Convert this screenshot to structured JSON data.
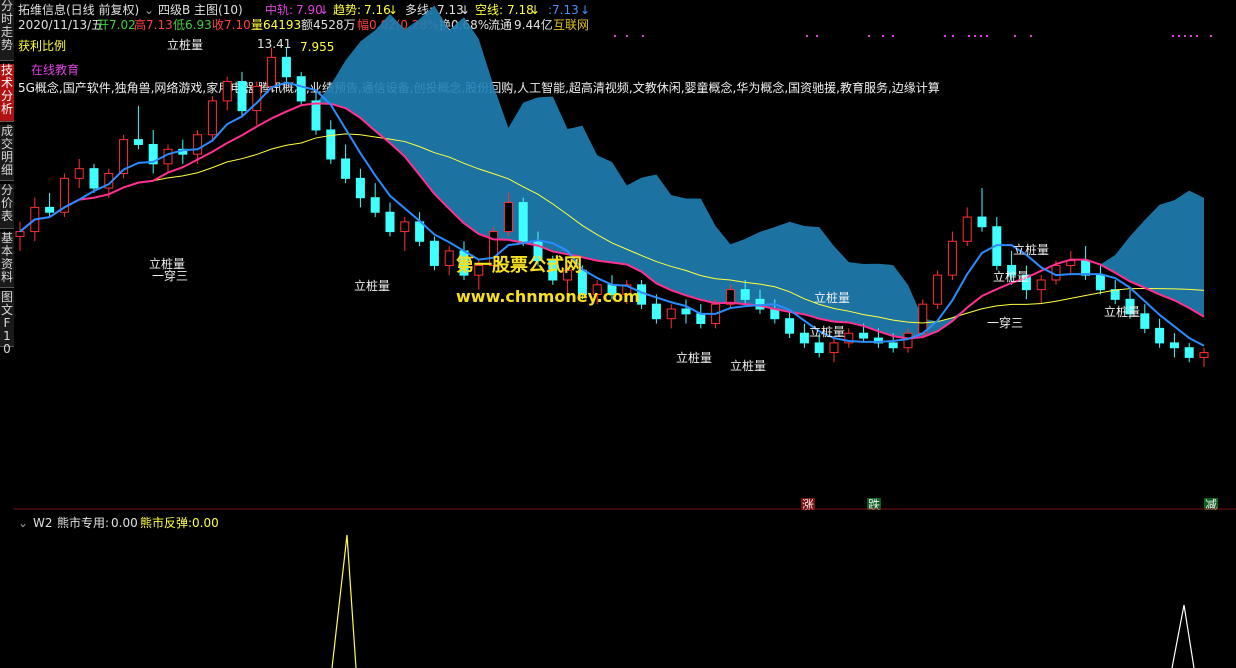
{
  "side_tabs": [
    {
      "label": "分时走势",
      "active": false
    },
    {
      "label": "技术分析",
      "active": true
    },
    {
      "label": "成交明细",
      "active": false
    },
    {
      "label": "分价表",
      "active": false
    },
    {
      "label": "基本资料",
      "active": false
    },
    {
      "label": "图文F10",
      "active": false
    }
  ],
  "header": {
    "stock_title": "拓维信息(日线 前复权)",
    "indicator_name": "四级B 主图(10)",
    "zhonggui_label": "中轨:",
    "zhonggui_value": "7.90",
    "qushi_label": "趋势:",
    "qushi_value": "7.16",
    "duoxian_label": "多线:",
    "duoxian_value": "7.13",
    "kongxian_label": "空线:",
    "kongxian_value": "7.18",
    "extra_value": ":7.13"
  },
  "quote": {
    "date": "2020/11/13/五",
    "open_label": "开",
    "open": "7.02",
    "high_label": "高",
    "high": "7.13",
    "low_label": "低",
    "low": "6.93",
    "close_label": "收",
    "close": "7.10",
    "vol_label": "量",
    "vol": "64193",
    "amount_label": "额",
    "amount": "4528万",
    "change_label": "幅",
    "change": "0.02(0.28%)",
    "turnover_label": "换",
    "turnover": "0.68%",
    "float_label": "流通",
    "float_cap": "9.44亿",
    "source": "互联网"
  },
  "info": {
    "profit_ratio": "获利比例",
    "concept_main": "在线教育",
    "concepts": "5G概念,国产软件,独角兽,网络游戏,家用电器,腾讯概念,业绩预告,通信设备,创投概念,股份回购,人工智能,超高清视频,文教休闲,婴童概念,华为概念,国资驰援,教育服务,边缘计算",
    "high_marker": "13.41",
    "price_tag": "7.955"
  },
  "annotations": {
    "lizhuangliang": "立桩量",
    "yiyasan": "一穿三",
    "zhang": "涨",
    "die": "跌",
    "jian": "减"
  },
  "watermark": {
    "title": "第一股票公式网",
    "url": "www.chnmoney.com"
  },
  "sub_panel": {
    "name": "W2",
    "label1": "熊市专用:",
    "value1": "0.00",
    "label2": "熊市反弹:",
    "value2": "0.00"
  },
  "chart_data": {
    "type": "candlestick",
    "ylim": [
      5.5,
      13.6
    ],
    "candles": [
      [
        9.5,
        9.8,
        9.2,
        9.6
      ],
      [
        9.6,
        10.3,
        9.4,
        10.1
      ],
      [
        10.1,
        10.4,
        9.9,
        10.0
      ],
      [
        10.0,
        10.8,
        9.9,
        10.7
      ],
      [
        10.7,
        11.1,
        10.5,
        10.9
      ],
      [
        10.9,
        11.0,
        10.4,
        10.5
      ],
      [
        10.5,
        10.9,
        10.3,
        10.8
      ],
      [
        10.8,
        11.6,
        10.7,
        11.5
      ],
      [
        11.5,
        12.2,
        11.3,
        11.4
      ],
      [
        11.4,
        11.7,
        10.8,
        11.0
      ],
      [
        11.0,
        11.4,
        10.8,
        11.3
      ],
      [
        11.3,
        11.5,
        11.0,
        11.2
      ],
      [
        11.2,
        11.7,
        11.0,
        11.6
      ],
      [
        11.6,
        12.4,
        11.5,
        12.3
      ],
      [
        12.3,
        12.8,
        12.1,
        12.7
      ],
      [
        12.7,
        12.9,
        12.0,
        12.1
      ],
      [
        12.1,
        12.7,
        11.8,
        12.6
      ],
      [
        12.6,
        13.4,
        12.5,
        13.2
      ],
      [
        13.2,
        13.41,
        12.7,
        12.8
      ],
      [
        12.8,
        12.9,
        12.2,
        12.3
      ],
      [
        12.3,
        12.5,
        11.6,
        11.7
      ],
      [
        11.7,
        11.9,
        11.0,
        11.1
      ],
      [
        11.1,
        11.4,
        10.6,
        10.7
      ],
      [
        10.7,
        10.9,
        10.1,
        10.3
      ],
      [
        10.3,
        10.6,
        9.9,
        10.0
      ],
      [
        10.0,
        10.2,
        9.5,
        9.6
      ],
      [
        9.6,
        9.9,
        9.2,
        9.8
      ],
      [
        9.8,
        10.0,
        9.3,
        9.4
      ],
      [
        9.4,
        9.5,
        8.8,
        8.9
      ],
      [
        8.9,
        9.3,
        8.7,
        9.2
      ],
      [
        9.2,
        9.4,
        8.6,
        8.7
      ],
      [
        8.7,
        9.0,
        8.4,
        8.9
      ],
      [
        8.9,
        9.7,
        8.8,
        9.6
      ],
      [
        9.6,
        10.4,
        9.5,
        10.2
      ],
      [
        10.2,
        10.3,
        9.3,
        9.4
      ],
      [
        9.4,
        9.6,
        8.9,
        9.0
      ],
      [
        9.0,
        9.1,
        8.5,
        8.6
      ],
      [
        8.6,
        8.9,
        8.3,
        8.8
      ],
      [
        8.8,
        8.9,
        8.2,
        8.3
      ],
      [
        8.3,
        8.6,
        8.1,
        8.5
      ],
      [
        8.5,
        8.7,
        8.2,
        8.3
      ],
      [
        8.3,
        8.6,
        8.1,
        8.5
      ],
      [
        8.5,
        8.6,
        8.0,
        8.1
      ],
      [
        8.1,
        8.3,
        7.7,
        7.8
      ],
      [
        7.8,
        8.1,
        7.6,
        8.0
      ],
      [
        8.0,
        8.2,
        7.7,
        7.9
      ],
      [
        7.9,
        8.1,
        7.6,
        7.7
      ],
      [
        7.7,
        8.2,
        7.6,
        8.1
      ],
      [
        8.1,
        8.5,
        8.0,
        8.4
      ],
      [
        8.4,
        8.6,
        8.1,
        8.2
      ],
      [
        8.2,
        8.4,
        7.9,
        8.0
      ],
      [
        8.0,
        8.2,
        7.7,
        7.8
      ],
      [
        7.8,
        8.0,
        7.4,
        7.5
      ],
      [
        7.5,
        7.7,
        7.2,
        7.3
      ],
      [
        7.3,
        7.5,
        7.0,
        7.1
      ],
      [
        7.1,
        7.4,
        6.9,
        7.3
      ],
      [
        7.3,
        7.6,
        7.2,
        7.5
      ],
      [
        7.5,
        7.7,
        7.3,
        7.4
      ],
      [
        7.4,
        7.6,
        7.2,
        7.3
      ],
      [
        7.3,
        7.5,
        7.1,
        7.2
      ],
      [
        7.2,
        7.6,
        7.1,
        7.5
      ],
      [
        7.5,
        8.2,
        7.4,
        8.1
      ],
      [
        8.1,
        8.8,
        8.0,
        8.7
      ],
      [
        8.7,
        9.6,
        8.6,
        9.4
      ],
      [
        9.4,
        10.1,
        9.3,
        9.9
      ],
      [
        9.9,
        10.5,
        9.6,
        9.7
      ],
      [
        9.7,
        9.9,
        8.8,
        8.9
      ],
      [
        8.9,
        9.2,
        8.5,
        8.7
      ],
      [
        8.7,
        8.9,
        8.2,
        8.4
      ],
      [
        8.4,
        8.7,
        8.1,
        8.6
      ],
      [
        8.6,
        9.0,
        8.5,
        8.9
      ],
      [
        8.9,
        9.2,
        8.7,
        9.0
      ],
      [
        9.0,
        9.3,
        8.6,
        8.7
      ],
      [
        8.7,
        8.9,
        8.3,
        8.4
      ],
      [
        8.4,
        8.6,
        8.1,
        8.2
      ],
      [
        8.2,
        8.4,
        7.8,
        7.9
      ],
      [
        7.9,
        8.1,
        7.5,
        7.6
      ],
      [
        7.6,
        7.8,
        7.2,
        7.3
      ],
      [
        7.3,
        7.5,
        7.0,
        7.2
      ],
      [
        7.2,
        7.3,
        6.9,
        7.0
      ],
      [
        7.0,
        7.2,
        6.8,
        7.1
      ]
    ]
  }
}
